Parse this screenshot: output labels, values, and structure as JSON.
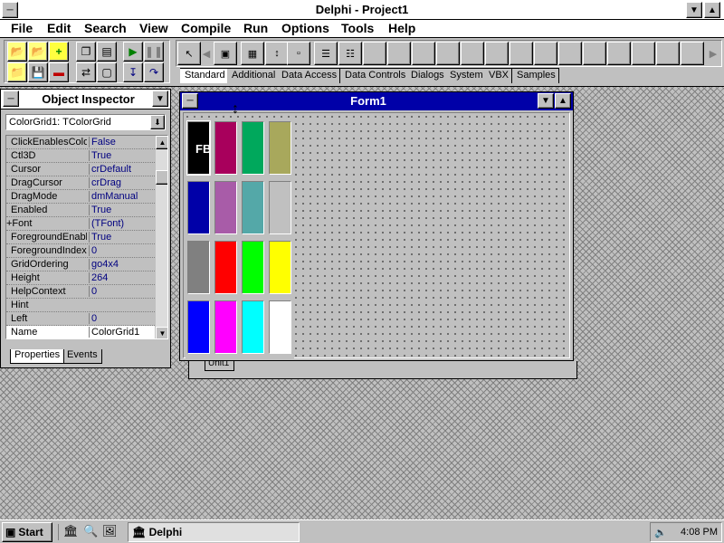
{
  "main_window": {
    "title": "Delphi - Project1",
    "menu": [
      "File",
      "Edit",
      "Search",
      "View",
      "Compile",
      "Run",
      "Options",
      "Tools",
      "Help"
    ],
    "palette_tabs": [
      "Standard",
      "Additional",
      "Data Access",
      "Data Controls",
      "Dialogs",
      "System",
      "VBX",
      "Samples"
    ],
    "selected_palette_tab": "Standard"
  },
  "object_inspector": {
    "title": "Object Inspector",
    "selected_component": "ColorGrid1: TColorGrid",
    "properties": [
      {
        "name": "ClickEnablesColo",
        "value": "False"
      },
      {
        "name": "Ctl3D",
        "value": "True"
      },
      {
        "name": "Cursor",
        "value": "crDefault"
      },
      {
        "name": "DragCursor",
        "value": "crDrag"
      },
      {
        "name": "DragMode",
        "value": "dmManual"
      },
      {
        "name": "Enabled",
        "value": "True"
      },
      {
        "name": "+Font",
        "value": "(TFont)"
      },
      {
        "name": "ForegroundEnabl",
        "value": "True"
      },
      {
        "name": "ForegroundIndex",
        "value": "0"
      },
      {
        "name": "GridOrdering",
        "value": "go4x4"
      },
      {
        "name": "Height",
        "value": "264"
      },
      {
        "name": "HelpContext",
        "value": "0"
      },
      {
        "name": "Hint",
        "value": ""
      },
      {
        "name": "Left",
        "value": "0"
      },
      {
        "name": "Name",
        "value": "ColorGrid1"
      }
    ],
    "selected_property": "Name",
    "tabs": [
      "Properties",
      "Events"
    ]
  },
  "form": {
    "title": "Form1",
    "unit_tab": "Unit1",
    "color_grid": {
      "label": "FB",
      "colors": [
        [
          "#000000",
          "#a8005c",
          "#00a85c",
          "#a8a85c"
        ],
        [
          "#0000a8",
          "#a85ca8",
          "#54a8a8",
          "#c0c0c0"
        ],
        [
          "#808080",
          "#ff0000",
          "#00ff00",
          "#ffff00"
        ],
        [
          "#0000ff",
          "#ff00ff",
          "#00ffff",
          "#ffffff"
        ]
      ]
    }
  },
  "taskbar": {
    "start_label": "Start",
    "task_label": "Delphi",
    "clock": "4:08 PM"
  }
}
